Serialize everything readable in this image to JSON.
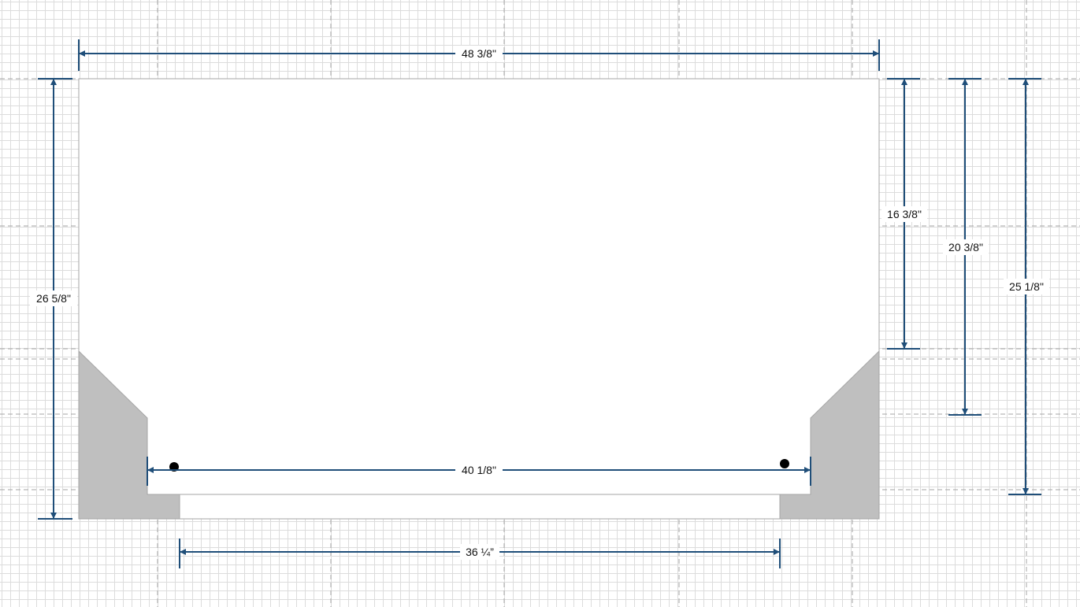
{
  "colors": {
    "dimension_line": "#1f4e79",
    "panel_fill": "#ffffff",
    "panel_stroke": "#a6a6a6",
    "block_fill": "#bfbfbf",
    "grid_line": "#dcdcdc",
    "grid_major": "#a6a6a6",
    "marker": "#000000"
  },
  "dimensions": {
    "overall_width": "48 3/8\"",
    "overall_height": "26 5/8\"",
    "inner_width": "40 1/8\"",
    "bottom_opening": "36 ¼”",
    "right_height_1": "16 3/8\"",
    "right_height_2": "20 3/8\"",
    "right_height_3": "25 1/8\""
  }
}
